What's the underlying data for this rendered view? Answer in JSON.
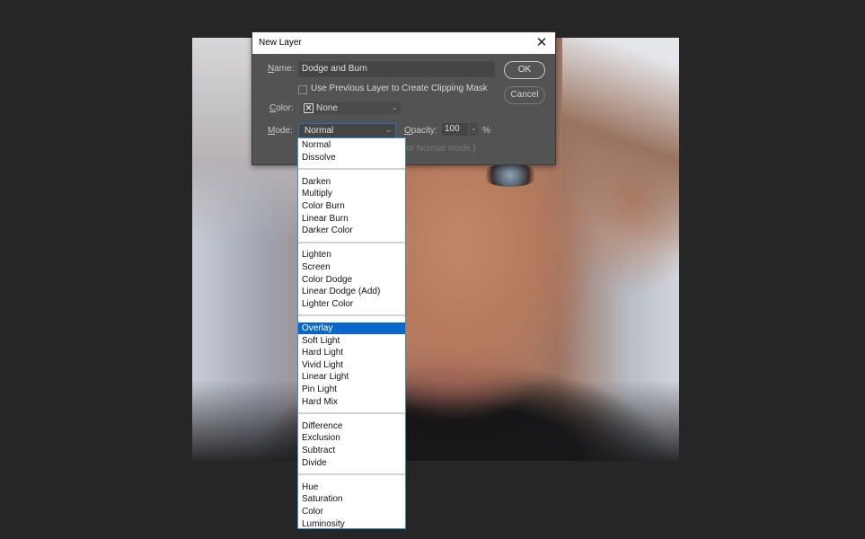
{
  "dialog": {
    "title": "New Layer",
    "close_label": "✕",
    "name_label_prefix": "N",
    "name_label_rest": "ame:",
    "name_value": "Dodge and Burn",
    "clipping_mask_label": "Use Previous Layer to Create Clipping Mask",
    "clipping_mask_checked": false,
    "color_label_prefix": "C",
    "color_label_rest": "olor:",
    "color_value": "None",
    "color_icon": "x-swatch-icon",
    "mode_label_prefix": "M",
    "mode_label_rest": "ode:",
    "mode_value": "Normal",
    "opacity_label_prefix": "O",
    "opacity_label_rest": "pacity:",
    "opacity_value": "100",
    "opacity_unit": "%",
    "hint_text": "or Normal mode.)",
    "ok_label": "OK",
    "cancel_label": "Cancel"
  },
  "mode_list": {
    "selected": "Overlay",
    "groups": [
      [
        "Normal",
        "Dissolve"
      ],
      [
        "Darken",
        "Multiply",
        "Color Burn",
        "Linear Burn",
        "Darker Color"
      ],
      [
        "Lighten",
        "Screen",
        "Color Dodge",
        "Linear Dodge (Add)",
        "Lighter Color"
      ],
      [
        "Overlay",
        "Soft Light",
        "Hard Light",
        "Vivid Light",
        "Linear Light",
        "Pin Light",
        "Hard Mix"
      ],
      [
        "Difference",
        "Exclusion",
        "Subtract",
        "Divide"
      ],
      [
        "Hue",
        "Saturation",
        "Color",
        "Luminosity"
      ]
    ]
  },
  "colors": {
    "app_background": "#262626",
    "dialog_background": "#535353",
    "selection_highlight": "#0a66c8",
    "focus_border": "#2f6ea8"
  }
}
